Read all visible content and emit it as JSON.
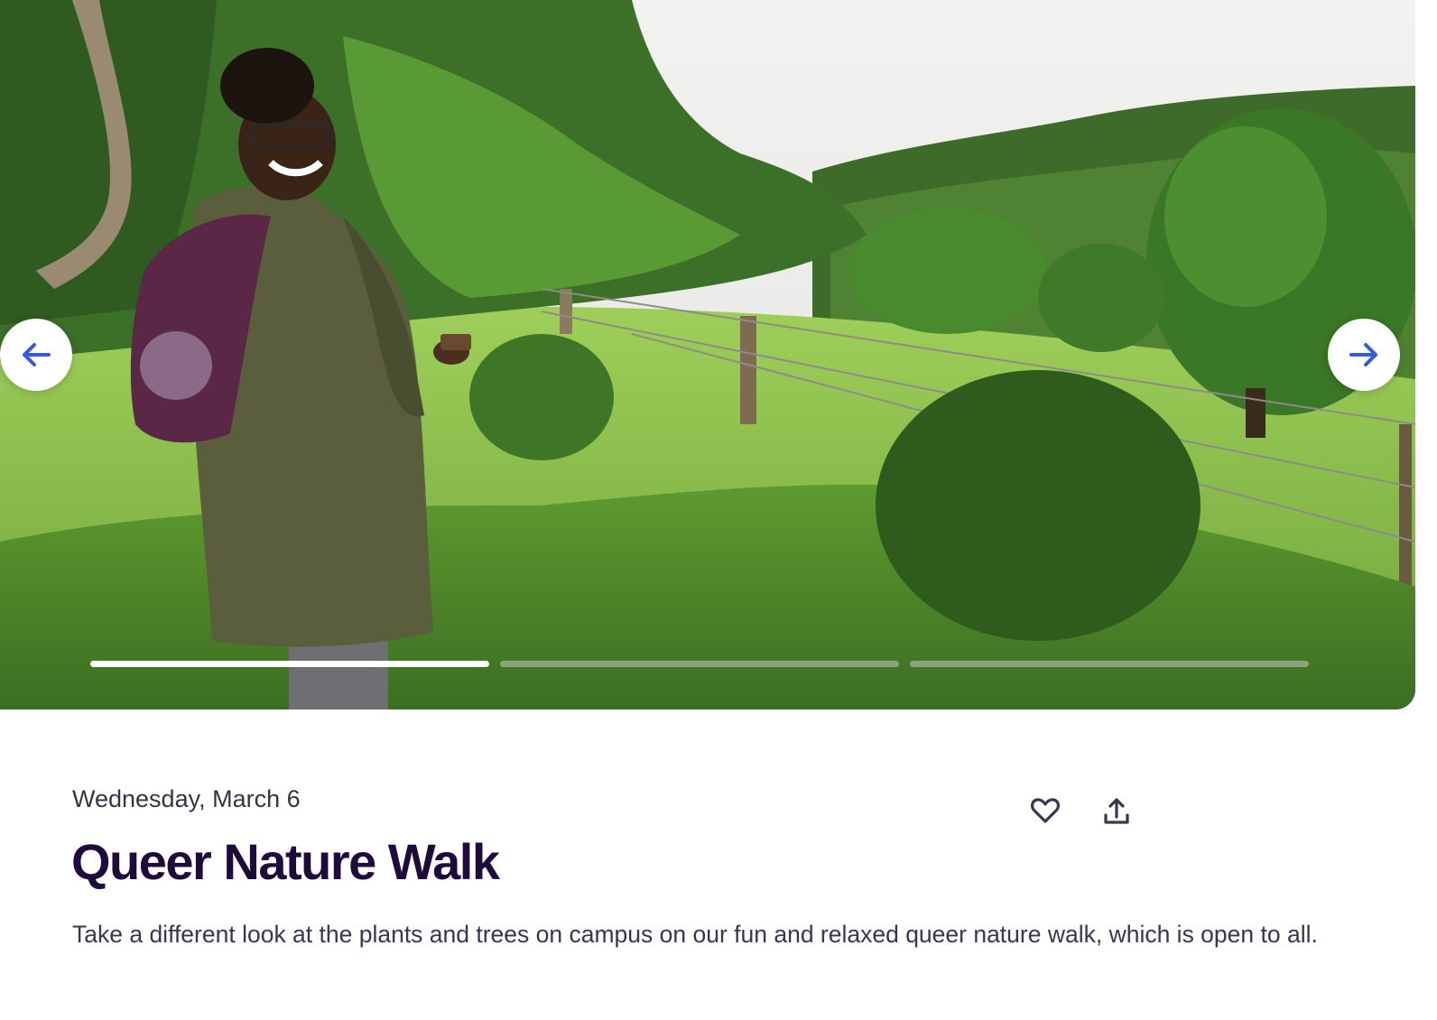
{
  "hero": {
    "slides": [
      "slide-1",
      "slide-2",
      "slide-3"
    ],
    "active_slide": 1,
    "prev_icon": "arrow-left-icon",
    "next_icon": "arrow-right-icon"
  },
  "event": {
    "date": "Wednesday, March 6",
    "title": "Queer Nature Walk",
    "summary": "Take a different look at the plants and trees on campus on our fun and relaxed queer nature walk, which is open to all.",
    "like_icon": "heart-icon",
    "share_icon": "share-icon"
  },
  "colors": {
    "accent": "#3659e3",
    "title": "#1e0a3c",
    "text": "#39364f"
  }
}
